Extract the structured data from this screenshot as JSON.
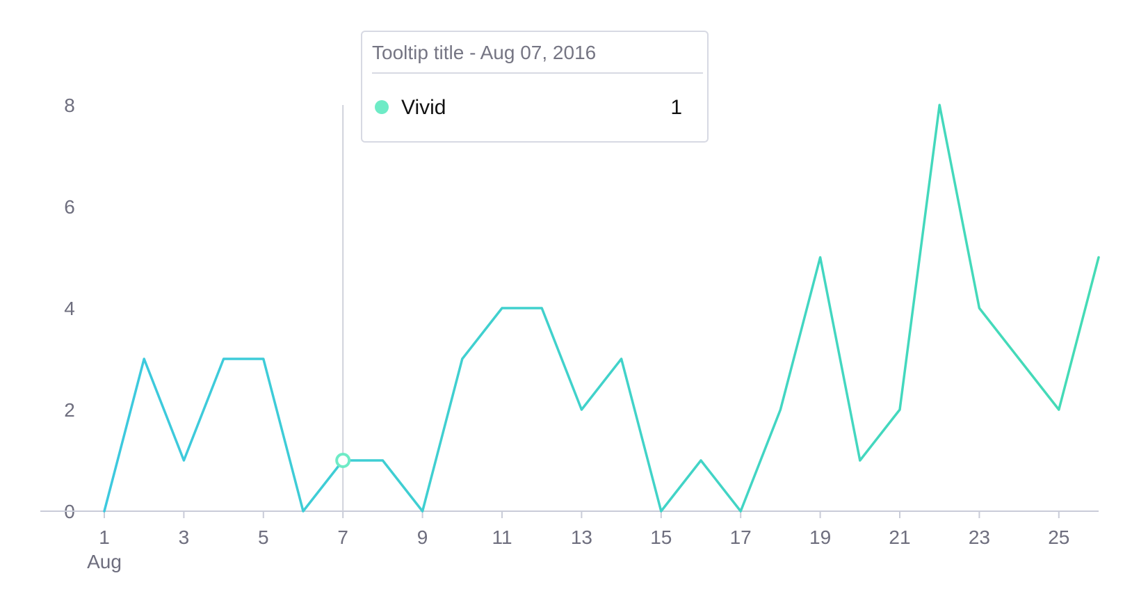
{
  "colors": {
    "line_start": "#3cc7e3",
    "line_end": "#45dcb4",
    "point": "#6eebc6",
    "axis": "#c9ccd8",
    "crosshair": "#cfd1db",
    "tick_text": "#6e6e7e"
  },
  "tooltip": {
    "title": "Tooltip title - Aug 07, 2016",
    "series_name": "Vivid",
    "value": "1",
    "dot_color": "#6eebc6"
  },
  "chart_data": {
    "type": "line",
    "title": "",
    "xlabel": "",
    "ylabel": "",
    "x": [
      "2016-08-01",
      "2016-08-02",
      "2016-08-03",
      "2016-08-04",
      "2016-08-05",
      "2016-08-06",
      "2016-08-07",
      "2016-08-08",
      "2016-08-09",
      "2016-08-10",
      "2016-08-11",
      "2016-08-12",
      "2016-08-13",
      "2016-08-14",
      "2016-08-15",
      "2016-08-16",
      "2016-08-17",
      "2016-08-18",
      "2016-08-19",
      "2016-08-20",
      "2016-08-21",
      "2016-08-22",
      "2016-08-23",
      "2016-08-24",
      "2016-08-25",
      "2016-08-26"
    ],
    "series": [
      {
        "values": [
          0,
          3,
          1,
          3,
          3,
          0,
          1,
          1,
          0,
          3,
          4,
          4,
          2,
          3,
          0,
          1,
          0,
          2,
          5,
          1,
          2,
          8,
          4,
          3,
          2,
          5
        ]
      }
    ],
    "x_tick_labels": [
      "1",
      "3",
      "5",
      "7",
      "9",
      "11",
      "13",
      "15",
      "17",
      "19",
      "21",
      "23",
      "25"
    ],
    "x_tick_days": [
      1,
      3,
      5,
      7,
      9,
      11,
      13,
      15,
      17,
      19,
      21,
      23,
      25
    ],
    "x_month_label": "Aug",
    "y_ticks": [
      0,
      2,
      4,
      6,
      8
    ],
    "y_tick_labels": [
      "0",
      "2",
      "4",
      "6",
      "8"
    ],
    "ylim": [
      0,
      8
    ],
    "xlim": [
      "2016-07-30",
      "2016-08-26"
    ],
    "highlighted_x": "2016-08-07",
    "highlighted_value": 1,
    "grid": false,
    "legend": "none"
  }
}
